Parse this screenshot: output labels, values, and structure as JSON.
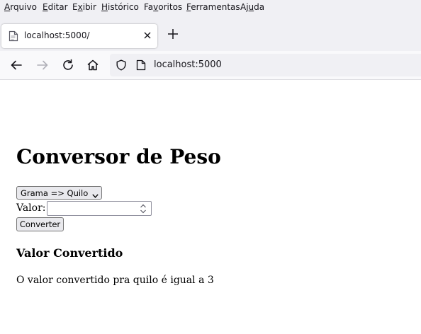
{
  "menu": [
    {
      "label": "Arquivo",
      "accel_pre": "",
      "accel": "A",
      "accel_post": "rquivo"
    },
    {
      "label": "Editar",
      "accel_pre": "",
      "accel": "E",
      "accel_post": "ditar"
    },
    {
      "label": "Exibir",
      "accel_pre": "E",
      "accel": "x",
      "accel_post": "ibir"
    },
    {
      "label": "Histórico",
      "accel_pre": "",
      "accel": "H",
      "accel_post": "istórico"
    },
    {
      "label": "Favoritos",
      "accel_pre": "Fa",
      "accel": "v",
      "accel_post": "oritos"
    },
    {
      "label": "Ferramentas",
      "accel_pre": "",
      "accel": "F",
      "accel_post": "erramentas"
    },
    {
      "label": "Ajuda",
      "accel_pre": "Aj",
      "accel": "u",
      "accel_post": "da"
    }
  ],
  "tab": {
    "title": "localhost:5000/",
    "close_icon": "close-icon",
    "favicon": "page-icon"
  },
  "newtab_icon": "plus-icon",
  "nav": {
    "back_icon": "arrow-left-icon",
    "forward_icon": "arrow-right-icon",
    "reload_icon": "reload-icon",
    "home_icon": "home-icon"
  },
  "urlbar": {
    "url": "localhost:5000",
    "shield_icon": "shield-icon",
    "page_icon": "page-icon"
  },
  "page": {
    "heading": "Conversor de Peso",
    "select_value": "Grama => Quilo",
    "value_label": "Valor:",
    "value_input": "",
    "convert_button": "Converter",
    "result_heading": "Valor Convertido",
    "result_text": "O valor convertido pra quilo é igual a 3"
  },
  "colors": {
    "chrome_bg": "#f0f0f4",
    "navbar_bg": "#f9f9fb",
    "text": "#15141a"
  }
}
